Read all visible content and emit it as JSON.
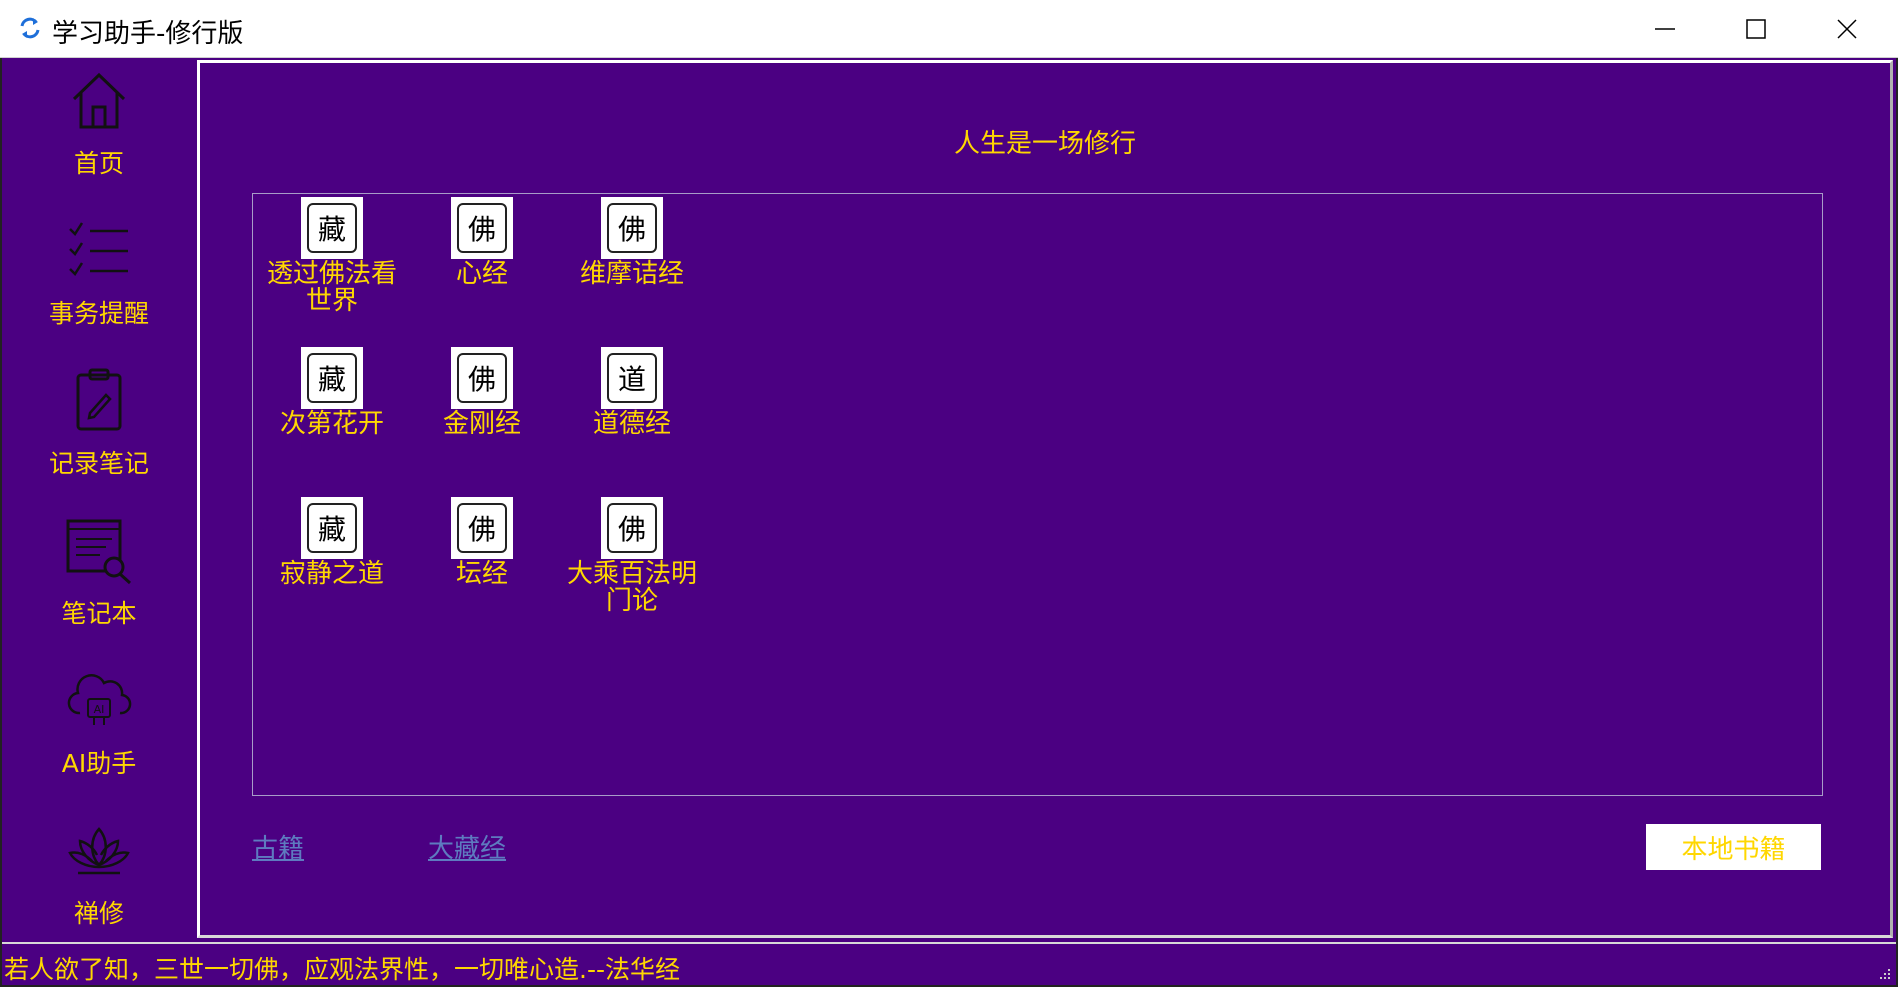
{
  "window": {
    "title": "学习助手-修行版",
    "app_icon": "refresh-arrows-icon",
    "minimize_icon": "minimize-icon",
    "maximize_icon": "maximize-icon",
    "close_icon": "close-icon"
  },
  "sidebar": {
    "items": [
      {
        "label": "首页",
        "icon": "home-icon"
      },
      {
        "label": "事务提醒",
        "icon": "checklist-icon"
      },
      {
        "label": "记录笔记",
        "icon": "clipboard-pen-icon"
      },
      {
        "label": "笔记本",
        "icon": "notebook-search-icon"
      },
      {
        "label": "AI助手",
        "icon": "ai-cloud-icon"
      },
      {
        "label": "禅修",
        "icon": "lotus-icon"
      }
    ]
  },
  "main": {
    "title": "人生是一场修行",
    "books": [
      {
        "icon_char": "藏",
        "line1": "透过佛法看",
        "line2": "世界"
      },
      {
        "icon_char": "佛",
        "line1": "心经",
        "line2": ""
      },
      {
        "icon_char": "佛",
        "line1": "维摩诘经",
        "line2": ""
      },
      {
        "icon_char": "藏",
        "line1": "次第花开",
        "line2": ""
      },
      {
        "icon_char": "佛",
        "line1": "金刚经",
        "line2": ""
      },
      {
        "icon_char": "道",
        "line1": "道德经",
        "line2": ""
      },
      {
        "icon_char": "藏",
        "line1": "寂静之道",
        "line2": ""
      },
      {
        "icon_char": "佛",
        "line1": "坛经",
        "line2": ""
      },
      {
        "icon_char": "佛",
        "line1": "大乘百法明",
        "line2": "门论"
      }
    ],
    "links": {
      "ancient": "古籍",
      "tripitaka": "大藏经"
    },
    "local_books_button": "本地书籍"
  },
  "status": {
    "quote": "若人欲了知，三世一切佛，应观法界性，一切唯心造.--法华经"
  },
  "colors": {
    "background": "#4b0082",
    "text_gold": "#ffd700",
    "link": "#5e7bc0"
  }
}
